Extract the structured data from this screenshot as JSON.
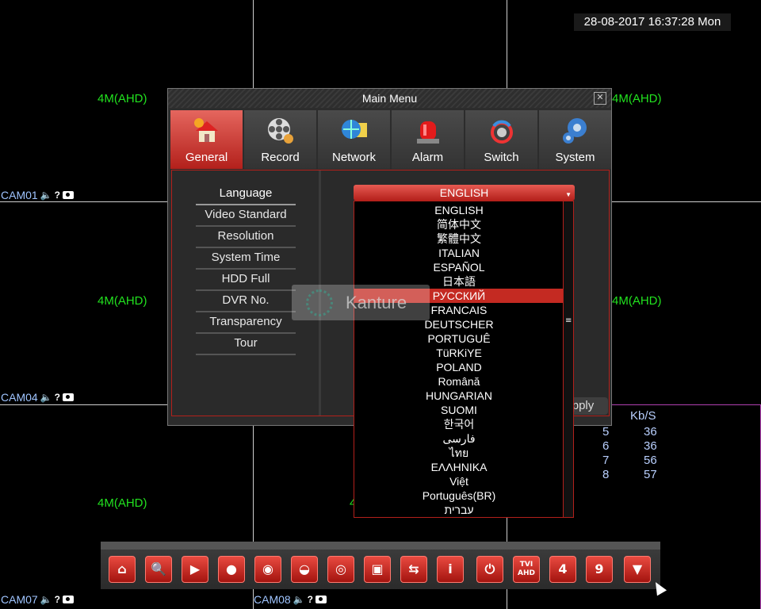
{
  "datetime": "28-08-2017 16:37:28 Mon",
  "grid": {
    "formats": [
      "4M(AHD)",
      "4M(AHD)",
      "4M(AHD)",
      "4M(AHD)",
      "4M(AHD)",
      "4M(AHD)",
      "4"
    ],
    "cams": [
      "CAM01",
      "CAM04",
      "CAM07",
      "CAM08"
    ]
  },
  "window": {
    "title": "Main Menu",
    "close": "✕",
    "tabs": [
      {
        "label": "General",
        "icon": "house-gear-icon"
      },
      {
        "label": "Record",
        "icon": "film-reel-icon"
      },
      {
        "label": "Network",
        "icon": "globe-monitor-icon"
      },
      {
        "label": "Alarm",
        "icon": "siren-icon"
      },
      {
        "label": "Switch",
        "icon": "dvr-nvr-hvr-switch-icon"
      },
      {
        "label": "System",
        "icon": "gears-icon"
      }
    ],
    "side_menu": [
      "Language",
      "Video Standard",
      "Resolution",
      "System Time",
      "HDD Full",
      "DVR No.",
      "Transparency",
      "Tour"
    ],
    "apply_label": "pply"
  },
  "language": {
    "selected": "ENGLISH",
    "options": [
      "ENGLISH",
      "简体中文",
      "繁體中文",
      "ITALIAN",
      "ESPAÑOL",
      "日本語",
      "РУССКИЙ",
      "FRANCAIS",
      "DEUTSCHER",
      "PORTUGUÊ",
      "TüRKiYE",
      "POLAND",
      "Română",
      "HUNGARIAN",
      "SUOMI",
      "한국어",
      "فارسی",
      "ไทย",
      "ΕΛΛΗΝΙΚΑ",
      "Việt",
      "Português(BR)",
      "עברית"
    ],
    "highlighted": "РУССКИЙ"
  },
  "watermark": "Kanture",
  "stats": {
    "header": "Kb/S",
    "rows": [
      {
        "ch": "5",
        "kbps": "36"
      },
      {
        "ch": "6",
        "kbps": "36"
      },
      {
        "ch": "7",
        "kbps": "56"
      },
      {
        "ch": "8",
        "kbps": "57"
      }
    ]
  },
  "toolbar": {
    "buttons": [
      {
        "icon": "home-icon",
        "text": "⌂"
      },
      {
        "icon": "search-icon",
        "text": "🔍"
      },
      {
        "icon": "playback-icon",
        "text": "▶"
      },
      {
        "icon": "record-settings-icon",
        "text": "●"
      },
      {
        "icon": "ptz-icon",
        "text": "◉"
      },
      {
        "icon": "color-icon",
        "text": "◒"
      },
      {
        "icon": "camera-settings-icon",
        "text": "◎"
      },
      {
        "icon": "single-view-icon",
        "text": "▣"
      },
      {
        "icon": "sequence-icon",
        "text": "⇆"
      },
      {
        "icon": "info-icon",
        "text": "i"
      },
      {
        "icon": "power-icon",
        "text": "⏻"
      },
      {
        "icon": "tvi-ahd-icon",
        "text": "TVI AHD"
      },
      {
        "icon": "quad-view-icon",
        "text": "4"
      },
      {
        "icon": "nine-view-icon",
        "text": "9"
      },
      {
        "icon": "hide-toolbar-icon",
        "text": "▼"
      }
    ]
  }
}
